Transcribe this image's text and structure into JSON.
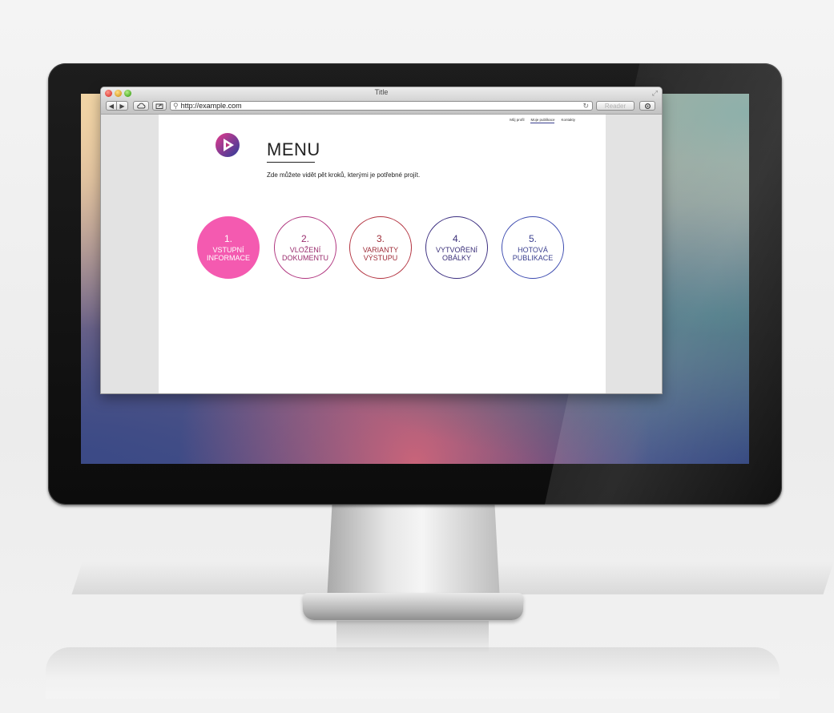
{
  "window": {
    "title": "Title",
    "url": "http://example.com",
    "reader_label": "Reader"
  },
  "nav": {
    "items": [
      "Můj profil",
      "Moje publikace",
      "Kontakty"
    ],
    "active_index": 1
  },
  "page": {
    "title": "MENU",
    "subtitle": "Zde můžete vidět pět kroků, kterými je potřebné projít."
  },
  "steps": [
    {
      "num": "1.",
      "line1": "VSTUPNÍ",
      "line2": "INFORMACE",
      "color": "#f45ab0"
    },
    {
      "num": "2.",
      "line1": "VLOŽENÍ",
      "line2": "DOKUMENTU",
      "color": "#b0357f"
    },
    {
      "num": "3.",
      "line1": "VARIANTY",
      "line2": "VÝSTUPU",
      "color": "#b33340"
    },
    {
      "num": "4.",
      "line1": "VYTVOŘENÍ",
      "line2": "OBÁLKY",
      "color": "#3b2e80"
    },
    {
      "num": "5.",
      "line1": "HOTOVÁ",
      "line2": "PUBLIKACE",
      "color": "#3d4bb0"
    }
  ],
  "icons": {
    "back": "◀",
    "forward": "▶",
    "reload": "↻",
    "url": "⚲",
    "resize": "⤢"
  },
  "colors": {
    "accent": "#f45ab0",
    "logo_start": "#e63a8c",
    "logo_end": "#2a3c9a"
  }
}
